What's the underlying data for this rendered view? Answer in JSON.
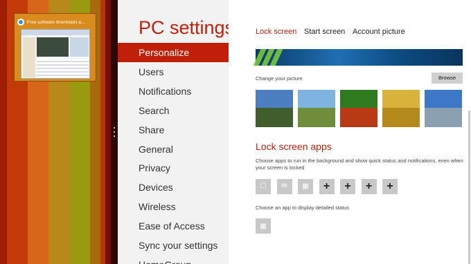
{
  "snapped_app": {
    "window_title": "Free software downloads a...",
    "stripe_colors": [
      "#a01e06",
      "#c23a08",
      "#d8661a",
      "#b8891a",
      "#9a9a10",
      "#a86a0e",
      "#b23a0a",
      "#7a0c0c"
    ]
  },
  "settings": {
    "app_title": "PC settings",
    "nav_items": [
      "Personalize",
      "Users",
      "Notifications",
      "Search",
      "Share",
      "General",
      "Privacy",
      "Devices",
      "Wireless",
      "Ease of Access",
      "Sync your settings",
      "HomeGroup"
    ],
    "selected_nav_item": "Personalize"
  },
  "main": {
    "tabs": [
      "Lock screen",
      "Start screen",
      "Account picture"
    ],
    "active_tab": "Lock screen",
    "change_picture_label": "Change your picture",
    "browse_label": "Browse",
    "pictures": [
      {
        "name": "mountain-lake",
        "sky": "#4c7fc2",
        "land": "#3f5e2c"
      },
      {
        "name": "coastline",
        "sky": "#7fb4e0",
        "land": "#6f8d3a"
      },
      {
        "name": "red-flowers",
        "sky": "#2f7a1e",
        "land": "#b83a12"
      },
      {
        "name": "golden-grass",
        "sky": "#d8b23a",
        "land": "#b58a1c"
      },
      {
        "name": "snowy-peaks-road",
        "sky": "#3d78c6",
        "land": "#8aa0b0"
      }
    ],
    "lock_screen_apps_heading": "Lock screen apps",
    "lock_screen_apps_description": "Choose apps to run in the background and show quick status and notifications, even when your screen is locked",
    "app_slots": [
      {
        "icon": "message-icon",
        "glyph": "☐",
        "kind": "app"
      },
      {
        "icon": "mail-icon",
        "glyph": "✉",
        "kind": "app"
      },
      {
        "icon": "calendar-icon",
        "glyph": "▦",
        "kind": "app"
      },
      {
        "icon": "add-icon",
        "glyph": "+",
        "kind": "add"
      },
      {
        "icon": "add-icon",
        "glyph": "+",
        "kind": "add"
      },
      {
        "icon": "add-icon",
        "glyph": "+",
        "kind": "add"
      },
      {
        "icon": "add-icon",
        "glyph": "+",
        "kind": "add"
      }
    ],
    "detailed_status_label": "Choose an app to display detailed status",
    "detailed_status_app": {
      "icon": "calendar-icon",
      "glyph": "▦"
    }
  },
  "colors": {
    "accent": "#c0200a",
    "nav_background": "#f2f2f2",
    "slot_background": "#c8c8c8"
  }
}
